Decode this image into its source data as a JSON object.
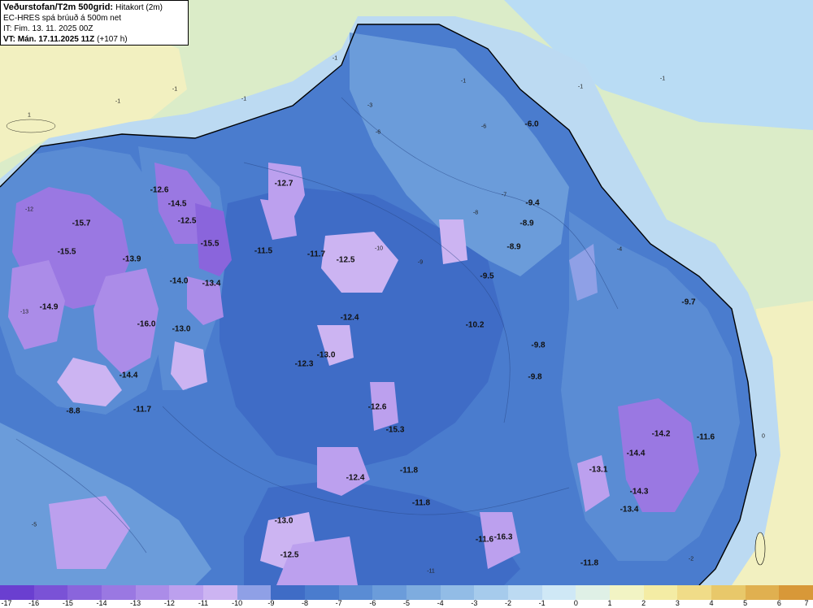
{
  "title": {
    "product": "Veðurstofan/T2m 500grid:",
    "subtitle": "Hitakort (2m)",
    "model": "EC-HRES spá brúuð á 500m net",
    "init": "IT: Fim. 13. 11. 2025 00Z",
    "valid_prefix": "VT: Mán. 17.11.2025 11Z",
    "valid_suffix": "(+107 h)"
  },
  "temp_labels": [
    "-15.7",
    "-15.5",
    "-13.9",
    "-14.9",
    "-16.0",
    "-14.4",
    "-8.8",
    "-11.7",
    "-12.6",
    "-14.5",
    "-12.5",
    "-15.5",
    "-13.4",
    "-14.0",
    "-13.0",
    "-12.7",
    "-11.5",
    "-11.7",
    "-12.5",
    "-12.4",
    "-13.0",
    "-12.3",
    "-12.6",
    "-15.3",
    "-12.4",
    "-11.8",
    "-11.8",
    "-13.0",
    "-12.5",
    "-6.0",
    "-9.4",
    "-8.9",
    "-8.9",
    "-9.5",
    "-10.2",
    "-9.8",
    "-9.8",
    "-11.6",
    "-16.3",
    "-11.8",
    "-9.7",
    "-14.2",
    "-11.6",
    "-14.4",
    "-13.1",
    "-14.3",
    "-13.4"
  ],
  "contour_labels": [
    "-1",
    "-1",
    "-1",
    "-1",
    "-1",
    "-1",
    "-1",
    "1",
    "-3",
    "-6",
    "-7",
    "-8",
    "-9",
    "-10",
    "-12",
    "-13",
    "-5",
    "-4",
    "-2",
    "0",
    "-11",
    "-6"
  ],
  "colorbar": {
    "ticks": [
      "-17",
      "-16",
      "-15",
      "-14",
      "-13",
      "-12",
      "-11",
      "-10",
      "-9",
      "-8",
      "-7",
      "-6",
      "-5",
      "-4",
      "-3",
      "-2",
      "-1",
      "0",
      "1",
      "2",
      "3",
      "4",
      "5",
      "6",
      "7"
    ],
    "colors": [
      "#6a3fd0",
      "#7a52d6",
      "#8a65dc",
      "#9a78e2",
      "#ab8ce8",
      "#bca0ee",
      "#ccb4f2",
      "#8fa0e6",
      "#3f6cc6",
      "#4a7cce",
      "#5a8cd4",
      "#6b9cda",
      "#7eacdf",
      "#92bce6",
      "#a6cbec",
      "#bcdaf2",
      "#cfe8f6",
      "#dff0e6",
      "#f2f4c4",
      "#f4eca4",
      "#f0dc88",
      "#e8c86a",
      "#e0b050",
      "#d89838"
    ]
  }
}
